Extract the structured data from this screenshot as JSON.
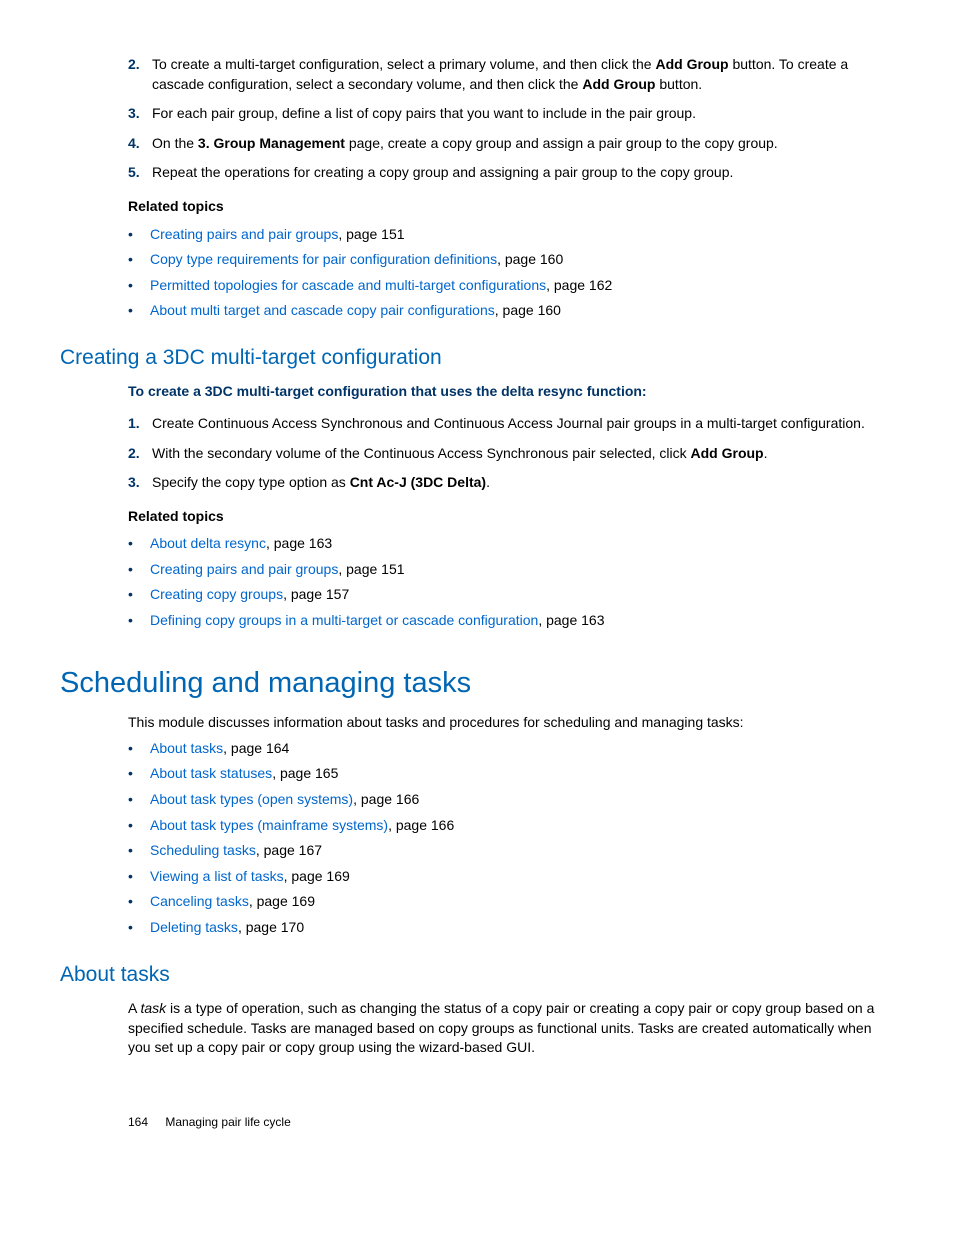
{
  "top_steps": [
    {
      "num": "2.",
      "html": "To create a multi-target configuration, select a primary volume, and then click the <span class='bold'>Add Group</span> button. To create a cascade configuration, select a secondary volume, and then click the <span class='bold'>Add Group</span> button."
    },
    {
      "num": "3.",
      "html": "For each pair group, define a list of copy pairs that you want to include in the pair group."
    },
    {
      "num": "4.",
      "html": "On the <span class='bold'>3. Group Management</span> page, create a copy group and assign a pair group to the copy group."
    },
    {
      "num": "5.",
      "html": "Repeat the operations for creating a copy group and assigning a pair group to the copy group."
    }
  ],
  "top_related_heading": "Related topics",
  "top_related": [
    {
      "link": "Creating pairs and pair groups",
      "tail": ", page 151"
    },
    {
      "link": "Copy type requirements for pair configuration definitions",
      "tail": ", page 160"
    },
    {
      "link": "Permitted topologies for cascade and multi-target configurations",
      "tail": ", page 162"
    },
    {
      "link": "About multi target and cascade copy pair configurations",
      "tail": ", page 160"
    }
  ],
  "sec_3dc_title": "Creating a 3DC multi-target configuration",
  "sec_3dc_intro": "To create a 3DC multi-target configuration that uses the delta resync function:",
  "sec_3dc_steps": [
    {
      "num": "1.",
      "html": "Create Continuous Access Synchronous and Continuous Access Journal pair groups in a multi-target configuration."
    },
    {
      "num": "2.",
      "html": "With the secondary volume of the Continuous Access Synchronous pair selected, click <span class='bold'>Add Group</span>."
    },
    {
      "num": "3.",
      "html": "Specify the copy type option as <span class='bold'>Cnt Ac-J (3DC Delta)</span>."
    }
  ],
  "sec_3dc_related_heading": "Related topics",
  "sec_3dc_related": [
    {
      "link": "About delta resync",
      "tail": ", page 163"
    },
    {
      "link": "Creating pairs and pair groups",
      "tail": ", page 151"
    },
    {
      "link": "Creating copy groups",
      "tail": ", page 157"
    },
    {
      "link": "Defining copy groups in a multi-target or cascade configuration",
      "tail": ", page 163"
    }
  ],
  "sched_title": "Scheduling and managing tasks",
  "sched_intro": "This module discusses information about tasks and procedures for scheduling and managing tasks:",
  "sched_links": [
    {
      "link": "About tasks",
      "tail": ", page 164"
    },
    {
      "link": "About task statuses",
      "tail": ", page 165"
    },
    {
      "link": "About task types (open systems)",
      "tail": ", page 166"
    },
    {
      "link": "About task types (mainframe systems)",
      "tail": ", page 166"
    },
    {
      "link": "Scheduling tasks",
      "tail": ", page 167"
    },
    {
      "link": "Viewing a list of tasks",
      "tail": ", page 169"
    },
    {
      "link": "Canceling tasks",
      "tail": ", page 169"
    },
    {
      "link": "Deleting tasks",
      "tail": ", page 170"
    }
  ],
  "about_tasks_title": "About tasks",
  "about_tasks_para": "A <span class='italic'>task</span> is a type of operation, such as changing the status of a copy pair or creating a copy pair or copy group based on a specified schedule. Tasks are managed based on copy groups as functional units. Tasks are created automatically when you set up a copy pair or copy group using the wizard-based GUI.",
  "footer_page": "164",
  "footer_chapter": "Managing pair life cycle"
}
